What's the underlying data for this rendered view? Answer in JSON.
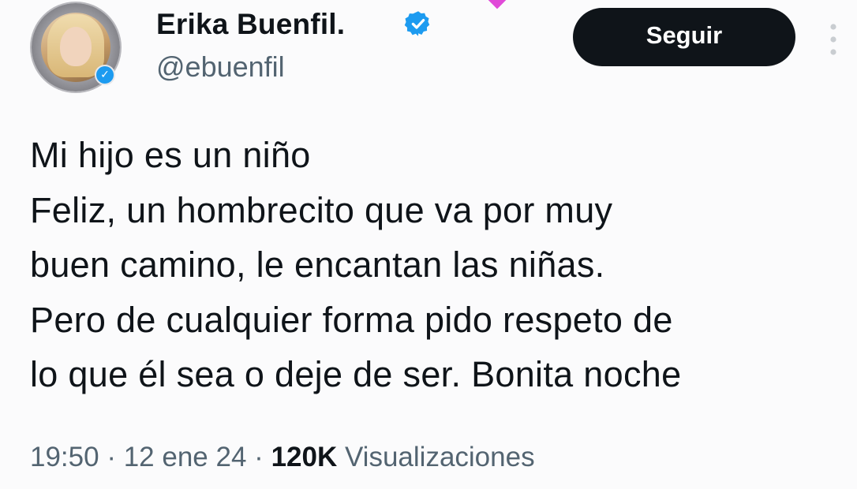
{
  "author": {
    "display_name": "Erika Buenfil.",
    "username": "@ebuenfil",
    "verified": true
  },
  "actions": {
    "follow_label": "Seguir"
  },
  "tweet": {
    "lines": [
      "Mi hijo es un niño",
      "Feliz, un hombrecito que va por muy",
      "buen camino, le encantan las niñas.",
      "Pero de cualquier forma pido respeto de",
      "lo que él sea o deje de ser.  Bonita noche"
    ]
  },
  "meta": {
    "time": "19:50",
    "separator": "·",
    "date": "12 ene 24",
    "views_count": "120K",
    "views_label": "Visualizaciones"
  },
  "colors": {
    "text": "#0f1419",
    "secondary_text": "#536471",
    "verified_blue": "#1d9bf0",
    "button_bg": "#0f1419"
  },
  "icons": {
    "verified": "verified-badge-icon",
    "more": "more-vertical-icon"
  }
}
